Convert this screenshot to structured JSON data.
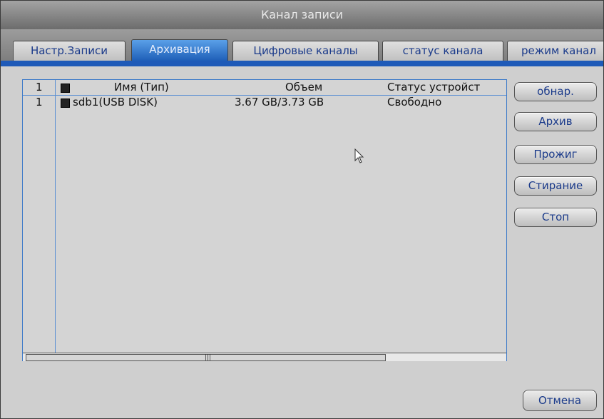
{
  "window": {
    "title": "Канал записи"
  },
  "tabs": [
    {
      "label": "Настр.Записи"
    },
    {
      "label": "Архивация"
    },
    {
      "label": "Цифровые каналы"
    },
    {
      "label": "статус канала"
    },
    {
      "label": "режим канал"
    }
  ],
  "active_tab": "Архивация",
  "table": {
    "header": {
      "index": "1",
      "name": "Имя (Тип)",
      "volume": "Объем",
      "status": "Статус устройст"
    },
    "rows": [
      {
        "index": "1",
        "name": "sdb1(USB DISK)",
        "volume": "3.67 GB/3.73 GB",
        "status": "Свободно"
      }
    ]
  },
  "buttons": {
    "detect": "обнар.",
    "archive": "Архив",
    "burn": "Прожиг",
    "erase": "Стирание",
    "stop": "Стоп",
    "cancel": "Отмена"
  },
  "scrollbar": {
    "grip": "|||"
  },
  "colors": {
    "accent": "#1e5ab8",
    "text_blue": "#1a3a8a",
    "titlebar": "#7e7e7e"
  }
}
